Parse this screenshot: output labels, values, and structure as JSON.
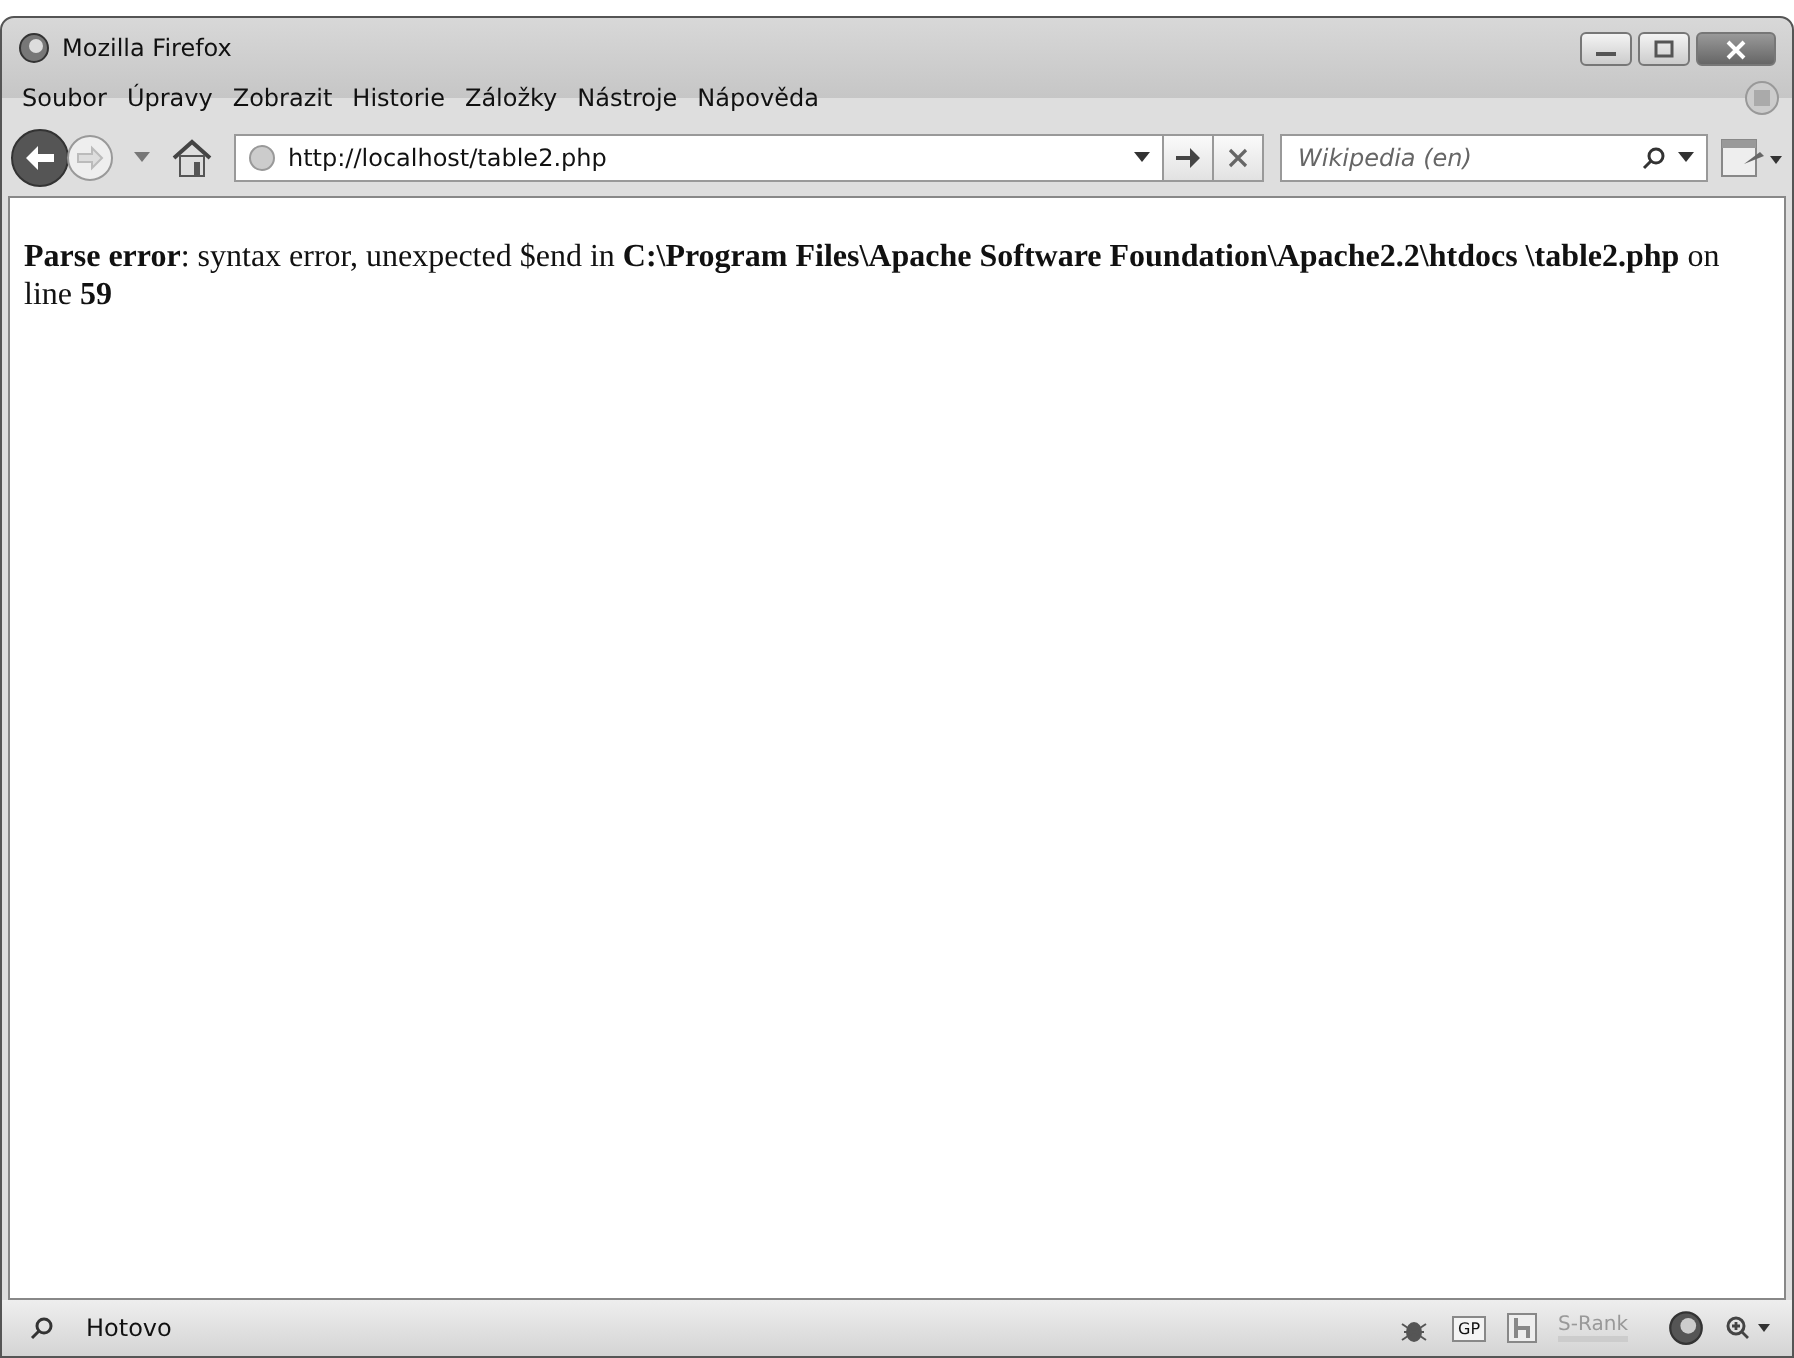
{
  "window": {
    "title": "Mozilla Firefox"
  },
  "menu": [
    "Soubor",
    "Úpravy",
    "Zobrazit",
    "Historie",
    "Záložky",
    "Nástroje",
    "Nápověda"
  ],
  "address": {
    "value": "http://localhost/table2.php"
  },
  "search": {
    "placeholder": "Wikipedia (en)"
  },
  "page": {
    "message": "**Parse error**: syntax error, unexpected $end in **C:\\Program Files\\Apache Software Foundation\\Apache2.2\\htdocs \\table2.php** on line **59**"
  },
  "status_bar": {
    "text": "Hotovo",
    "rank_label": "S-Rank",
    "gp_label": "GP"
  }
}
